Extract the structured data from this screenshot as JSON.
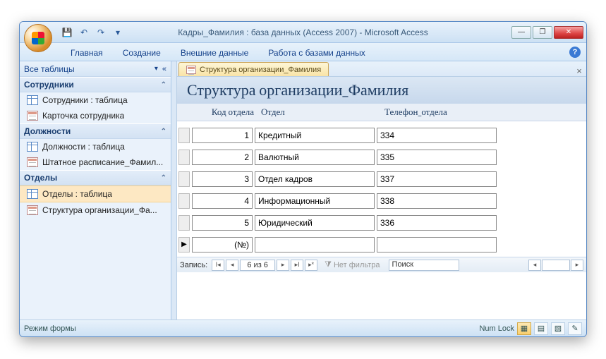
{
  "titlebar": {
    "title": "Кадры_Фамилия : база данных (Access 2007)  -  Microsoft Access"
  },
  "ribbon": {
    "tabs": [
      "Главная",
      "Создание",
      "Внешние данные",
      "Работа с базами данных"
    ]
  },
  "nav": {
    "header": "Все таблицы",
    "groups": [
      {
        "title": "Сотрудники",
        "items": [
          {
            "icon": "table",
            "label": "Сотрудники : таблица"
          },
          {
            "icon": "form",
            "label": "Карточка сотрудника"
          }
        ]
      },
      {
        "title": "Должности",
        "items": [
          {
            "icon": "table",
            "label": "Должности : таблица"
          },
          {
            "icon": "form",
            "label": "Штатное расписание_Фамил..."
          }
        ]
      },
      {
        "title": "Отделы",
        "items": [
          {
            "icon": "table",
            "label": "Отделы : таблица",
            "selected": true
          },
          {
            "icon": "form",
            "label": "Структура организации_Фа..."
          }
        ]
      }
    ]
  },
  "doc": {
    "tab_label": "Структура организации_Фамилия",
    "form_title": "Структура организации_Фамилия",
    "columns": {
      "code": "Код отдела",
      "dept": "Отдел",
      "phone": "Телефон_отдела"
    },
    "rows": [
      {
        "code": "1",
        "dept": "Кредитный",
        "phone": "334"
      },
      {
        "code": "2",
        "dept": "Валютный",
        "phone": "335"
      },
      {
        "code": "3",
        "dept": "Отдел кадров",
        "phone": "337"
      },
      {
        "code": "4",
        "dept": "Информационный",
        "phone": "338"
      },
      {
        "code": "5",
        "dept": "Юридический",
        "phone": "336"
      }
    ],
    "new_row_placeholder": "(№)"
  },
  "recnav": {
    "label": "Запись:",
    "position": "6 из 6",
    "filter": "Нет фильтра",
    "search": "Поиск"
  },
  "status": {
    "left": "Режим формы",
    "numlock": "Num Lock"
  }
}
